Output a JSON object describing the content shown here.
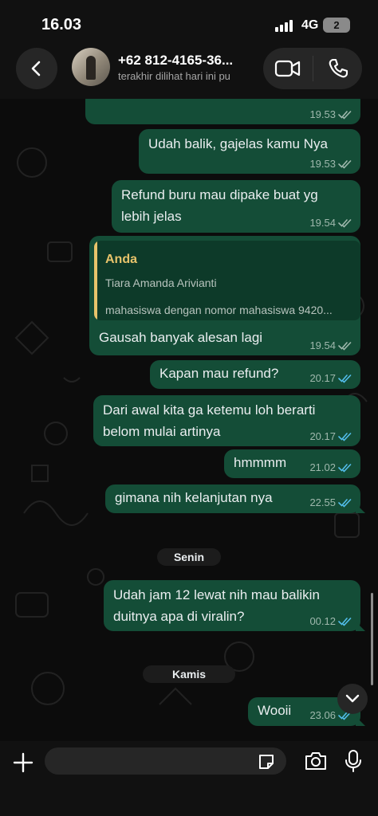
{
  "status_bar": {
    "time": "16.03",
    "network": "4G",
    "battery": "2"
  },
  "header": {
    "contact_name": "+62 812-4165-36...",
    "contact_status": "terakhir dilihat hari ini pu"
  },
  "messages": [
    {
      "text": "",
      "time": "19.53",
      "ticks": "read-grey"
    },
    {
      "text": "Udah balik, gajelas kamu Nya",
      "time": "19.53",
      "ticks": "read-grey"
    },
    {
      "text_lines": [
        "Refund buru mau dipake buat yg",
        "lebih jelas"
      ],
      "time": "19.54",
      "ticks": "read-grey"
    },
    {
      "quote": {
        "author": "Anda",
        "line1": "Tiara Amanda Arivianti",
        "line2": "mahasiswa dengan nomor mahasiswa 9420..."
      },
      "text": "Gausah banyak alesan lagi",
      "time": "19.54",
      "ticks": "read-grey"
    },
    {
      "text": "Kapan mau refund?",
      "time": "20.17",
      "ticks": "read-blue"
    },
    {
      "text_lines": [
        "Dari awal kita ga ketemu loh berarti",
        "belom mulai artinya"
      ],
      "time": "20.17",
      "ticks": "read-blue"
    },
    {
      "text": "hmmmm",
      "time": "21.02",
      "ticks": "read-blue"
    },
    {
      "text": "gimana nih kelanjutan nya",
      "time": "22.55",
      "ticks": "read-blue"
    },
    {
      "text_lines": [
        "Udah jam 12 lewat nih mau balikin",
        "duitnya apa di viralin?"
      ],
      "time": "00.12",
      "ticks": "read-blue"
    },
    {
      "text": "Wooii",
      "time": "23.06",
      "ticks": "read-blue"
    }
  ],
  "date_separators": [
    "Senin",
    "Kamis"
  ],
  "input": {
    "placeholder": ""
  },
  "colors": {
    "bubble_outgoing": "#144d37",
    "quote_accent": "#e7c36b",
    "tick_blue": "#53bdeb",
    "tick_grey": "#9fb8ad"
  },
  "icons": [
    "back-icon",
    "video-call-icon",
    "phone-icon",
    "double-check-icon",
    "chevron-down-icon",
    "plus-icon",
    "sticker-icon",
    "camera-icon",
    "microphone-icon"
  ]
}
